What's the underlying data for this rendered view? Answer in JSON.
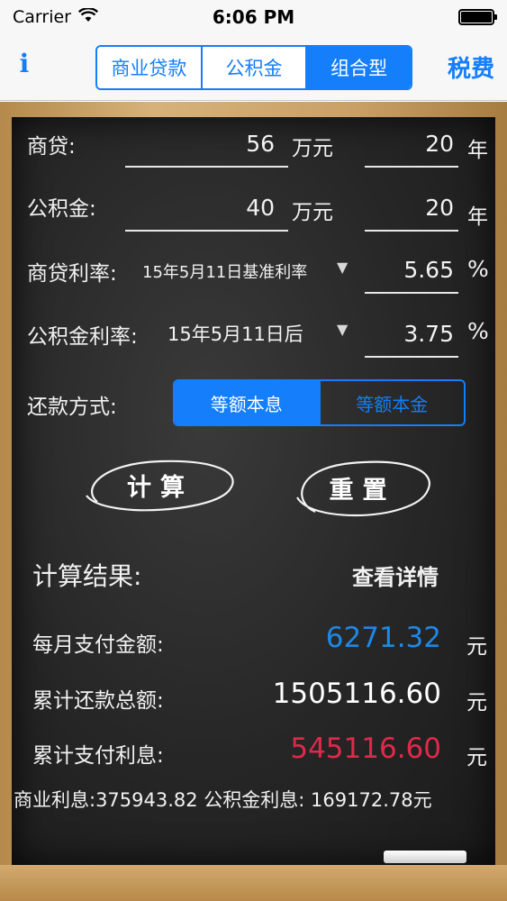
{
  "status_bar": {
    "carrier": "Carrier",
    "time": "6:06 PM"
  },
  "nav": {
    "info_label": "i",
    "loan_types": [
      "商业贷款",
      "公积金",
      "组合型"
    ],
    "selected_loan_type": "组合型",
    "tax_label": "税费"
  },
  "form": {
    "commercial": {
      "label": "商贷:",
      "amount": "56",
      "amount_unit": "万元",
      "years": "20",
      "years_unit": "年"
    },
    "fund": {
      "label": "公积金:",
      "amount": "40",
      "amount_unit": "万元",
      "years": "20",
      "years_unit": "年"
    },
    "commercial_rate": {
      "label": "商贷利率:",
      "option": "15年5月11日基准利率",
      "value": "5.65",
      "unit": "%"
    },
    "fund_rate": {
      "label": "公积金利率:",
      "option": "15年5月11日后",
      "value": "3.75",
      "unit": "%"
    },
    "repayment": {
      "label": "还款方式:",
      "options": [
        "等额本息",
        "等额本金"
      ],
      "selected": "等额本息"
    }
  },
  "buttons": {
    "calculate": "计算",
    "reset": "重置"
  },
  "results": {
    "title": "计算结果:",
    "details_link": "查看详情",
    "monthly": {
      "label": "每月支付金额:",
      "value": "6271.32",
      "unit": "元",
      "color": "#1e88e5"
    },
    "total": {
      "label": "累计还款总额:",
      "value": "1505116.60",
      "unit": "元",
      "color": "#ffffff"
    },
    "interest": {
      "label": "累计支付利息:",
      "value": "545116.60",
      "unit": "元",
      "color": "#e0294a"
    },
    "summary": "商业利息:375943.82 公积金利息: 169172.78元"
  },
  "colors": {
    "accent": "#147efb",
    "board": "#262626",
    "frame": "#c9a066"
  }
}
